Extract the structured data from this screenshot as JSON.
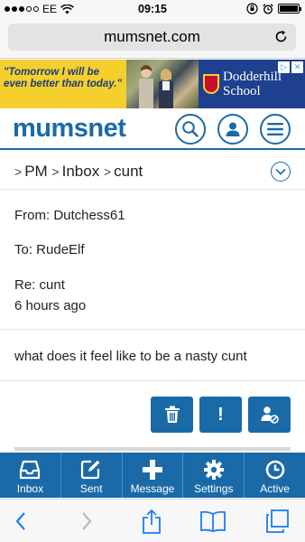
{
  "status_bar": {
    "carrier": "EE",
    "time": "09:15"
  },
  "browser": {
    "url": "mumsnet.com"
  },
  "ad": {
    "quote": "\"Tomorrow I will be even better than today.\"",
    "school_line1": "Dodderhill",
    "school_line2": "School"
  },
  "site": {
    "logo": "mumsnet"
  },
  "breadcrumb": {
    "items": [
      "PM",
      "Inbox",
      "cunt"
    ]
  },
  "message": {
    "from": "From: Dutchess61",
    "to": "To: RudeElf",
    "subject": "Re: cunt",
    "age": "6 hours ago",
    "body": "what does it feel like to be a nasty cunt"
  },
  "actions": {
    "report_label": "!"
  },
  "tabs": [
    {
      "label": "Inbox",
      "icon": "inbox-icon"
    },
    {
      "label": "Sent",
      "icon": "compose-icon"
    },
    {
      "label": "Message",
      "icon": "plus-icon"
    },
    {
      "label": "Settings",
      "icon": "gear-icon"
    },
    {
      "label": "Active",
      "icon": "clock-icon"
    }
  ],
  "colors": {
    "brand_blue": "#1a6aa8",
    "ad_yellow": "#f4cf2d",
    "ad_navy": "#1f3f8f"
  }
}
